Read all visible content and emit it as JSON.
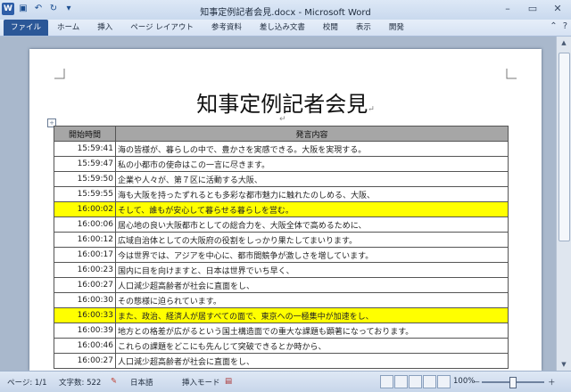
{
  "window": {
    "title": "知事定例記者会見.docx - Microsoft Word",
    "app_letter": "W"
  },
  "ribbon": {
    "tabs": [
      "ファイル",
      "ホーム",
      "挿入",
      "ページ レイアウト",
      "参考資料",
      "差し込み文書",
      "校閲",
      "表示",
      "開発"
    ]
  },
  "document": {
    "title": "知事定例記者会見",
    "table": {
      "headers": [
        "開始時間",
        "発言内容"
      ],
      "rows": [
        {
          "time": "15:59:41",
          "text": "海の皆様が、暮らしの中で、豊かさを実感できる。大阪を実現する。",
          "highlight": false
        },
        {
          "time": "15:59:47",
          "text": "私の小都市の使命はこの一言に尽きます。",
          "highlight": false
        },
        {
          "time": "15:59:50",
          "text": "企業や人々が、第７区に活動する大阪、",
          "highlight": false
        },
        {
          "time": "15:59:55",
          "text": "海も大阪を持ったずれるとも多彩な都市魅力に触れたのしめる、大阪、",
          "highlight": false
        },
        {
          "time": "16:00:02",
          "text": "そして、誰もが安心して暮らせる暮らしを営む。",
          "highlight": true
        },
        {
          "time": "16:00:06",
          "text": "居心地の良い大阪都市としての総合力を、大阪全体で高めるために、",
          "highlight": false
        },
        {
          "time": "16:00:12",
          "text": "広域自治体としての大阪府の役割をしっかり果たしてまいります。",
          "highlight": false
        },
        {
          "time": "16:00:17",
          "text": "今は世界では、アジアを中心に、都市間競争が激しさを増しています。",
          "highlight": false
        },
        {
          "time": "16:00:23",
          "text": "国内に目を向けますと、日本は世界でいち早く、",
          "highlight": false
        },
        {
          "time": "16:00:27",
          "text": "人口減少超高齢者が社会に直面をし、",
          "highlight": false
        },
        {
          "time": "16:00:30",
          "text": "その態様に迫られています。",
          "highlight": false
        },
        {
          "time": "16:00:33",
          "text": "また、政治、経済人が居すべての面で、東京への一極集中が加速をし、",
          "highlight": true
        },
        {
          "time": "16:00:39",
          "text": "地方との格差が広がるという国土構造面での重大な課題も顕著になっております。",
          "highlight": false
        },
        {
          "time": "16:00:46",
          "text": "これらの課題をどこにも先んじて突破できるとか時から、",
          "highlight": false
        },
        {
          "time": "16:00:27",
          "text": "人口減少超高齢者が社会に直面をし、",
          "highlight": false
        }
      ]
    }
  },
  "status": {
    "page": "ページ: 1/1",
    "words": "文字数: 522",
    "language": "日本語",
    "mode": "挿入モード",
    "zoom": "100%",
    "zoom_minus": "－",
    "zoom_plus": "＋"
  }
}
